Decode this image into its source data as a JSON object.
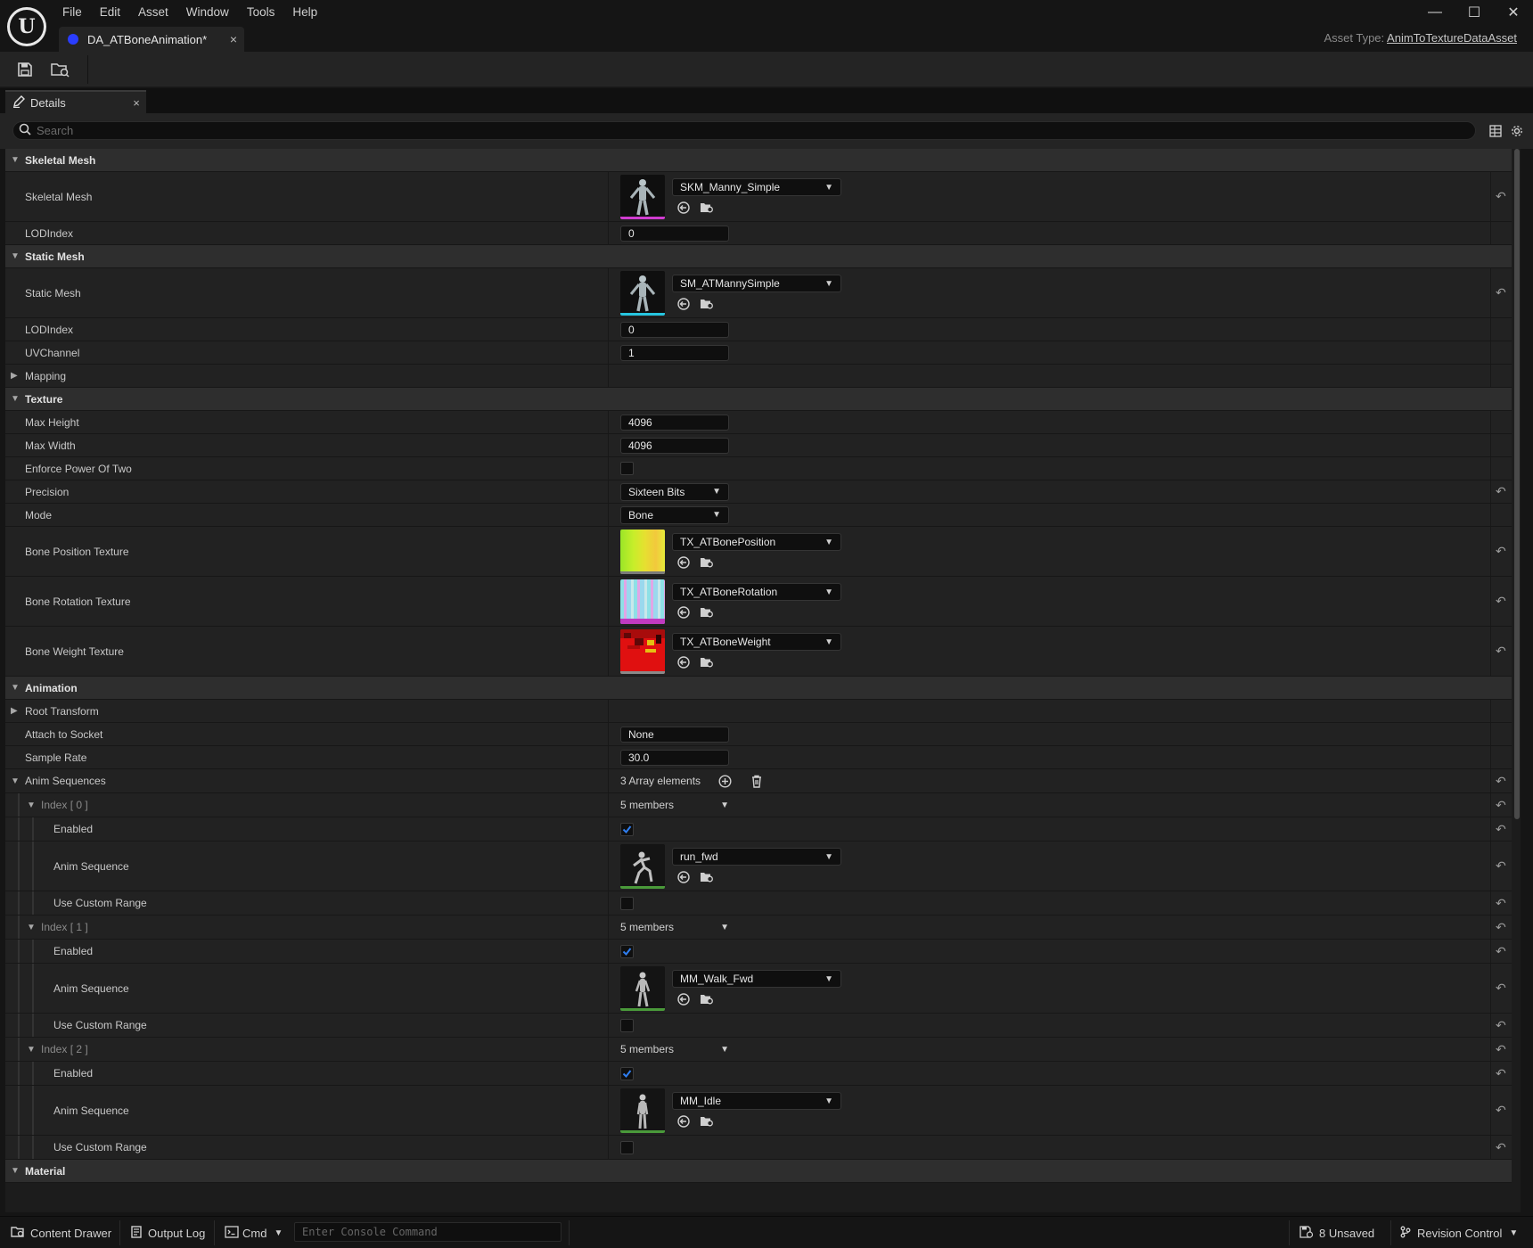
{
  "menubar": {
    "items": [
      "File",
      "Edit",
      "Asset",
      "Window",
      "Tools",
      "Help"
    ]
  },
  "window_controls": {
    "minimize": "—",
    "maximize": "☐",
    "close": "✕"
  },
  "document_tab": {
    "label": "DA_ATBoneAnimation*",
    "close": "×"
  },
  "asset_type": {
    "label": "Asset Type:",
    "value": "AnimToTextureDataAsset"
  },
  "panel_tab": {
    "label": "Details",
    "close": "×"
  },
  "search": {
    "placeholder": "Search"
  },
  "colors": {
    "accent": "#1f6fe0",
    "doc_dot": "#2a3dff"
  },
  "sections": {
    "skeletal": {
      "title": "Skeletal Mesh",
      "skeletal_mesh": {
        "label": "Skeletal Mesh",
        "value": "SKM_Manny_Simple"
      },
      "lod": {
        "label": "LODIndex",
        "value": "0"
      }
    },
    "static": {
      "title": "Static Mesh",
      "static_mesh": {
        "label": "Static Mesh",
        "value": "SM_ATMannySimple"
      },
      "lod": {
        "label": "LODIndex",
        "value": "0"
      },
      "uv": {
        "label": "UVChannel",
        "value": "1"
      },
      "mapping": {
        "label": "Mapping"
      }
    },
    "texture": {
      "title": "Texture",
      "max_height": {
        "label": "Max Height",
        "value": "4096"
      },
      "max_width": {
        "label": "Max Width",
        "value": "4096"
      },
      "enforce": {
        "label": "Enforce Power Of Two",
        "checked": false
      },
      "precision": {
        "label": "Precision",
        "value": "Sixteen Bits"
      },
      "mode": {
        "label": "Mode",
        "value": "Bone"
      },
      "bone_pos": {
        "label": "Bone Position Texture",
        "value": "TX_ATBonePosition"
      },
      "bone_rot": {
        "label": "Bone Rotation Texture",
        "value": "TX_ATBoneRotation"
      },
      "bone_weight": {
        "label": "Bone Weight Texture",
        "value": "TX_ATBoneWeight"
      }
    },
    "animation": {
      "title": "Animation",
      "root_transform": {
        "label": "Root Transform"
      },
      "attach_socket": {
        "label": "Attach to Socket",
        "value": "None"
      },
      "sample_rate": {
        "label": "Sample Rate",
        "value": "30.0"
      },
      "anim_sequences": {
        "label": "Anim Sequences",
        "value": "3 Array elements"
      },
      "indices": [
        {
          "label": "Index [ 0 ]",
          "members": "5 members",
          "enabled_label": "Enabled",
          "enabled": true,
          "seq_label": "Anim Sequence",
          "seq_value": "run_fwd",
          "custom_label": "Use Custom Range",
          "custom": false
        },
        {
          "label": "Index [ 1 ]",
          "members": "5 members",
          "enabled_label": "Enabled",
          "enabled": true,
          "seq_label": "Anim Sequence",
          "seq_value": "MM_Walk_Fwd",
          "custom_label": "Use Custom Range",
          "custom": false
        },
        {
          "label": "Index [ 2 ]",
          "members": "5 members",
          "enabled_label": "Enabled",
          "enabled": true,
          "seq_label": "Anim Sequence",
          "seq_value": "MM_Idle",
          "custom_label": "Use Custom Range",
          "custom": false
        }
      ]
    },
    "material": {
      "title": "Material"
    }
  },
  "statusbar": {
    "content_drawer": "Content Drawer",
    "output_log": "Output Log",
    "cmd": "Cmd",
    "console_placeholder": "Enter Console Command",
    "unsaved": "8 Unsaved",
    "revision_control": "Revision Control"
  }
}
